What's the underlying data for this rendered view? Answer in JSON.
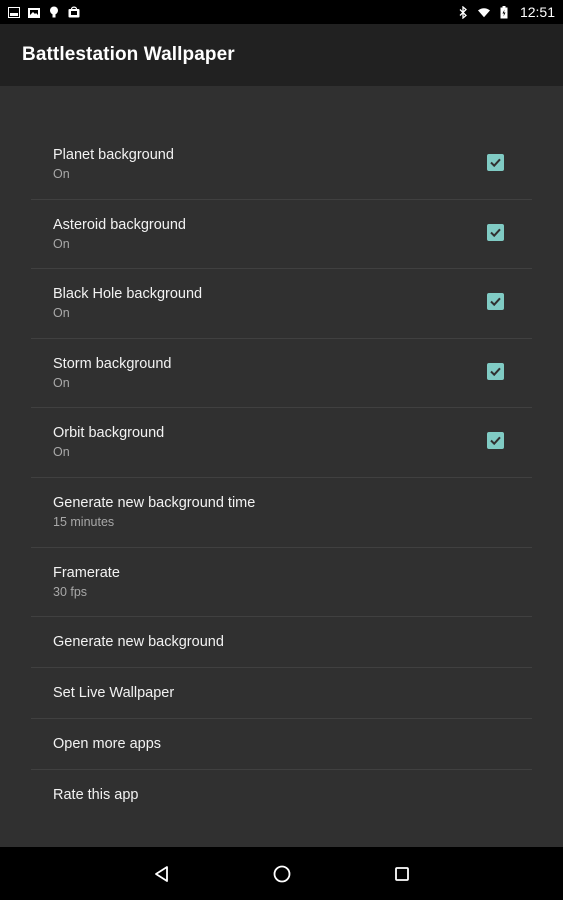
{
  "status_bar": {
    "left_icons": [
      "gallery-icon",
      "photos-icon",
      "bulb-icon",
      "shop-icon"
    ],
    "right_icons": [
      "bluetooth-icon",
      "wifi-icon",
      "battery-icon"
    ],
    "time": "12:51"
  },
  "app_bar": {
    "title": "Battlestation Wallpaper"
  },
  "preferences": [
    {
      "title": "Planet background",
      "summary": "On",
      "checked": true
    },
    {
      "title": "Asteroid background",
      "summary": "On",
      "checked": true
    },
    {
      "title": "Black Hole background",
      "summary": "On",
      "checked": true
    },
    {
      "title": "Storm background",
      "summary": "On",
      "checked": true
    },
    {
      "title": "Orbit background",
      "summary": "On",
      "checked": true
    },
    {
      "title": "Generate new background time",
      "summary": "15 minutes"
    },
    {
      "title": "Framerate",
      "summary": "30 fps"
    },
    {
      "title": "Generate new background"
    },
    {
      "title": "Set Live Wallpaper"
    },
    {
      "title": "Open more apps"
    },
    {
      "title": "Rate this app"
    }
  ],
  "nav_bar": {
    "buttons": [
      "back-icon",
      "home-icon",
      "recents-icon"
    ]
  },
  "colors": {
    "accent": "#80cbc4",
    "background": "#303030",
    "app_bar": "#212121"
  }
}
